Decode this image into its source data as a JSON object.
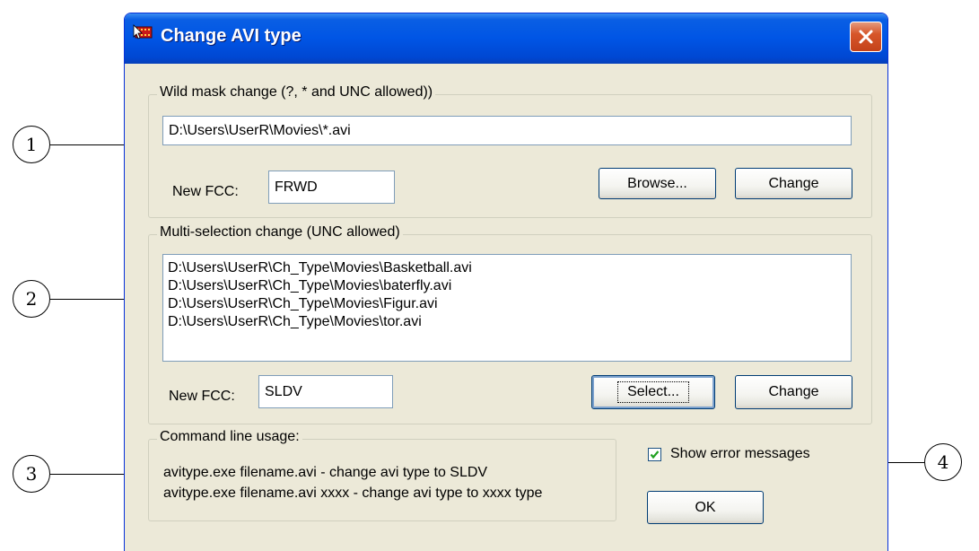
{
  "window": {
    "title": "Change AVI type"
  },
  "wild_mask": {
    "group_label": "Wild mask change (?, * and UNC allowed))",
    "path_value": "D:\\Users\\UserR\\Movies\\*.avi",
    "fcc_label": "New FCC:",
    "fcc_value": "FRWD",
    "browse_label": "Browse...",
    "change_label": "Change"
  },
  "multi_selection": {
    "group_label": "Multi-selection change (UNC allowed)",
    "files": [
      "D:\\Users\\UserR\\Ch_Type\\Movies\\Basketball.avi",
      "D:\\Users\\UserR\\Ch_Type\\Movies\\baterfly.avi",
      "D:\\Users\\UserR\\Ch_Type\\Movies\\Figur.avi",
      "D:\\Users\\UserR\\Ch_Type\\Movies\\tor.avi"
    ],
    "fcc_label": "New FCC:",
    "fcc_value": "SLDV",
    "select_label": "Select...",
    "change_label": "Change"
  },
  "command_line": {
    "group_label": "Command line usage:",
    "lines": [
      "avitype.exe filename.avi - change avi type to SLDV",
      "avitype.exe filename.avi xxxx - change avi type to xxxx type"
    ]
  },
  "options": {
    "show_errors_label": "Show error messages",
    "show_errors_checked": true,
    "ok_label": "OK"
  },
  "callouts": [
    "1",
    "2",
    "3",
    "4"
  ],
  "colors": {
    "titlebar": "#0055e5",
    "face": "#ece9d8",
    "close_button": "#d7562a"
  }
}
